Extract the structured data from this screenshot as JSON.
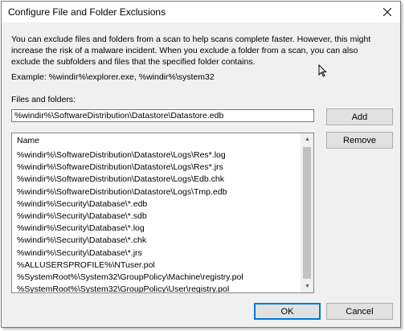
{
  "window": {
    "title": "Configure File and Folder Exclusions",
    "close_glyph": "✕"
  },
  "description": "You can exclude files and folders from a scan to help scans complete faster. However, this might increase the risk of a malware incident. When you exclude a folder from a scan, you can also exclude the subfolders and files that the specified folder contains.",
  "example": "Example: %windir%\\explorer.exe, %windir%\\system32",
  "files_label": "Files and folders:",
  "path_input": {
    "value": "%windir%\\SoftwareDistribution\\Datastore\\Datastore.edb"
  },
  "buttons": {
    "add": "Add",
    "remove": "Remove",
    "ok": "OK",
    "cancel": "Cancel"
  },
  "list": {
    "column": "Name",
    "items": [
      "%windir%\\SoftwareDistribution\\Datastore\\Logs\\Res*.log",
      "%windir%\\SoftwareDistribution\\Datastore\\Logs\\Res*.jrs",
      "%windir%\\SoftwareDistribution\\Datastore\\Logs\\Edb.chk",
      "%windir%\\SoftwareDistribution\\Datastore\\Logs\\Tmp.edb",
      "%windir%\\Security\\Database\\*.edb",
      "%windir%\\Security\\Database\\*.sdb",
      "%windir%\\Security\\Database\\*.log",
      "%windir%\\Security\\Database\\*.chk",
      "%windir%\\Security\\Database\\*.jrs",
      "%ALLUSERSPROFILE%\\NTuser.pol",
      "%SystemRoot%\\System32\\GroupPolicy\\Machine\\registry.pol",
      "%SystemRoot%\\System32\\GroupPolicy\\User\\registry.pol"
    ]
  },
  "scrollbar": {
    "up_glyph": "▲",
    "down_glyph": "▼"
  }
}
